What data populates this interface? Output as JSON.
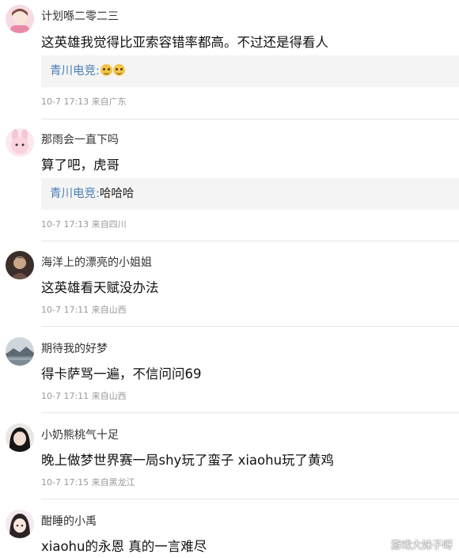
{
  "comments": [
    {
      "username": "计划喺二零二三",
      "text": "这英雄我觉得比亚索容错率都高。不过还是得看人",
      "reply": {
        "author": "青川电竞",
        "separator": ":",
        "emoji_icons": [
          "smug-face-emoji-icon",
          "smug-face-emoji-icon"
        ]
      },
      "meta": "10-7 17:13 来自广东",
      "avatar_icon": "avatar-girl-pink-icon"
    },
    {
      "username": "那雨会一直下吗",
      "text": "算了吧，虎哥",
      "reply": {
        "author": "青川电竞",
        "separator": ":",
        "text": "哈哈哈"
      },
      "meta": "10-7 17:13 来自四川",
      "avatar_icon": "avatar-pink-bunny-icon"
    },
    {
      "username": "海洋上的漂亮的小姐姐",
      "text": "这英雄看天赋没办法",
      "meta": "10-7 17:11 来自山西",
      "avatar_icon": "avatar-dark-photo-icon"
    },
    {
      "username": "期待我的好梦",
      "text": "得卡萨骂一遍，不信问问69",
      "meta": "10-7 17:11 来自山西",
      "avatar_icon": "avatar-landscape-icon"
    },
    {
      "username": "小奶熊桃气十足",
      "text": "晚上做梦世界赛一局shy玩了蛮子 xiaohu玩了黄鸡",
      "meta": "10-7 17:15 来自黑龙江",
      "avatar_icon": "avatar-girl-dark-hair-icon"
    },
    {
      "username": "酣睡的小禹",
      "text": "xiaohu的永恩 真的一言难尽",
      "avatar_icon": "avatar-anime-girl-icon"
    }
  ],
  "watermark": "游戏大妹子呀",
  "colors": {
    "reply_author": "#4a7fb5",
    "meta": "#999999",
    "reply_bg": "#f4f4f4",
    "divider": "#e6e6e6"
  }
}
